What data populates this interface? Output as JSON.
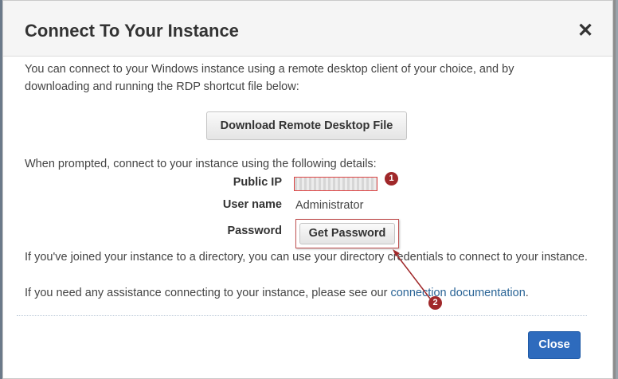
{
  "dialog": {
    "title": "Connect To Your Instance",
    "close_icon": "close-icon",
    "intro": "You can connect to your Windows instance using a remote desktop client of your choice, and by downloading and running the RDP shortcut file below:",
    "download_button": "Download Remote Desktop File",
    "prompt": "When prompted, connect to your instance using the following details:",
    "details": {
      "public_ip_label": "Public IP",
      "user_name_label": "User name",
      "user_name_value": "Administrator",
      "password_label": "Password",
      "get_password_button": "Get Password"
    },
    "directory_note": "If you've joined your instance to a directory, you can use your directory credentials to connect to your instance.",
    "assistance_prefix": "If you need any assistance connecting to your instance, please see our",
    "assistance_link": "connection documentation",
    "assistance_suffix": ".",
    "close_button": "Close"
  },
  "annotations": {
    "marker_1": "1",
    "marker_2": "2",
    "marker_color": "#a0282a"
  },
  "colors": {
    "primary_button": "#2e6bbd",
    "link": "#2a6496"
  }
}
